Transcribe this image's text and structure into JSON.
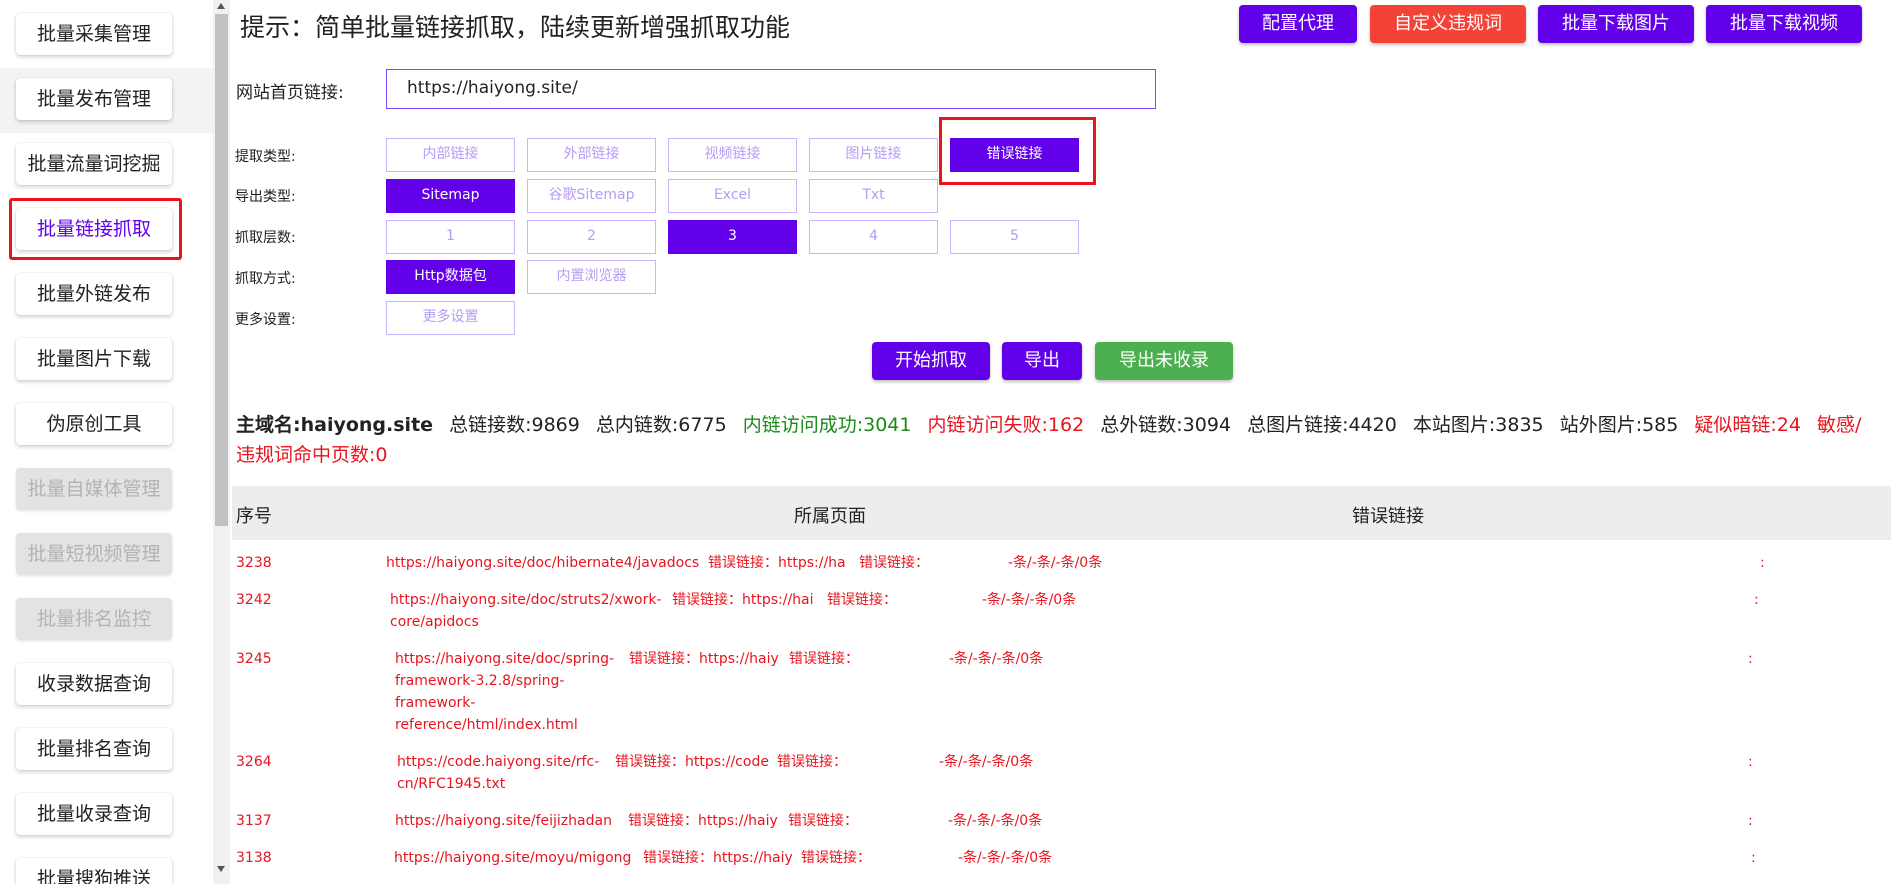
{
  "sidebar": {
    "items": [
      {
        "label": "批量采集管理",
        "state": "normal"
      },
      {
        "label": "批量发布管理",
        "state": "normal"
      },
      {
        "label": "批量流量词挖掘",
        "state": "normal"
      },
      {
        "label": "批量链接抓取",
        "state": "selected"
      },
      {
        "label": "批量外链发布",
        "state": "normal"
      },
      {
        "label": "批量图片下载",
        "state": "normal"
      },
      {
        "label": "伪原创工具",
        "state": "normal"
      },
      {
        "label": "批量自媒体管理",
        "state": "disabled"
      },
      {
        "label": "批量短视频管理",
        "state": "disabled"
      },
      {
        "label": "批量排名监控",
        "state": "disabled"
      },
      {
        "label": "收录数据查询",
        "state": "normal"
      },
      {
        "label": "批量排名查询",
        "state": "normal"
      },
      {
        "label": "批量收录查询",
        "state": "normal"
      },
      {
        "label": "批量搜狗推送",
        "state": "normal"
      }
    ]
  },
  "header": {
    "tip": "提示：简单批量链接抓取，陆续更新增强抓取功能",
    "buttons": [
      "配置代理",
      "自定义违规词",
      "批量下载图片",
      "批量下载视频"
    ]
  },
  "form": {
    "url_label": "网站首页链接:",
    "url_value": "https://haiyong.site/",
    "extract_label": "提取类型:",
    "extract_options": [
      "内部链接",
      "外部链接",
      "视频链接",
      "图片链接",
      "错误链接"
    ],
    "extract_selected": 4,
    "export_label": "导出类型:",
    "export_options": [
      "Sitemap",
      "谷歌Sitemap",
      "Excel",
      "Txt"
    ],
    "export_selected": 0,
    "depth_label": "抓取层数:",
    "depth_options": [
      "1",
      "2",
      "3",
      "4",
      "5"
    ],
    "depth_selected": 2,
    "method_label": "抓取方式:",
    "method_options": [
      "Http数据包",
      "内置浏览器"
    ],
    "method_selected": 0,
    "more_label": "更多设置:",
    "more_button": "更多设置"
  },
  "actions": {
    "start": "开始抓取",
    "export": "导出",
    "export_unindexed": "导出未收录"
  },
  "stats": {
    "domain": "主域名:haiyong.site",
    "total": "总链接数:9869",
    "internal": "总内链数:6775",
    "success": "内链访问成功:3041",
    "fail": "内链访问失败:162",
    "external": "总外链数:3094",
    "images": "总图片链接:4420",
    "local_images": "本站图片:3835",
    "external_images": "站外图片:585",
    "dark_links": "疑似暗链:24",
    "sensitive": "敏感/违规词命中页数:0"
  },
  "table": {
    "headers": [
      "序号",
      "所属页面",
      "错误链接"
    ],
    "rows": [
      {
        "id": "3238",
        "page": "https://haiyong.site/doc/hibernate4/javadocs",
        "err1": "错误链接：https://ha",
        "err2": "错误链接：",
        "count": "-条/-条/-条/0条",
        "tail": ":"
      },
      {
        "id": "3242",
        "page": "https://haiyong.site/doc/struts2/xwork-core/apidocs",
        "err1": "错误链接：https://hai",
        "err2": "错误链接：",
        "count": "-条/-条/-条/0条",
        "tail": ":"
      },
      {
        "id": "3245",
        "page": "https://haiyong.site/doc/spring-framework-3.2.8/spring-framework-reference/html/index.html",
        "err1": "错误链接：https://haiy",
        "err2": "错误链接：",
        "count": "-条/-条/-条/0条",
        "tail": ":"
      },
      {
        "id": "3264",
        "page": "https://code.haiyong.site/rfc-cn/RFC1945.txt",
        "err1": "错误链接：https://code",
        "err2": "错误链接：",
        "count": "-条/-条/-条/0条",
        "tail": ":"
      },
      {
        "id": "3137",
        "page": "https://haiyong.site/feijizhadan",
        "err1": "错误链接：https://haiy",
        "err2": "错误链接：",
        "count": "-条/-条/-条/0条",
        "tail": ":"
      },
      {
        "id": "3138",
        "page": "https://haiyong.site/moyu/migong",
        "err1": "错误链接：https://haiy",
        "err2": "错误链接：",
        "count": "-条/-条/-条/0条",
        "tail": ":"
      }
    ]
  },
  "colors": {
    "primary": "#6200ea",
    "danger": "#f44336",
    "success": "#4caf50",
    "error_text": "#e8141e"
  }
}
